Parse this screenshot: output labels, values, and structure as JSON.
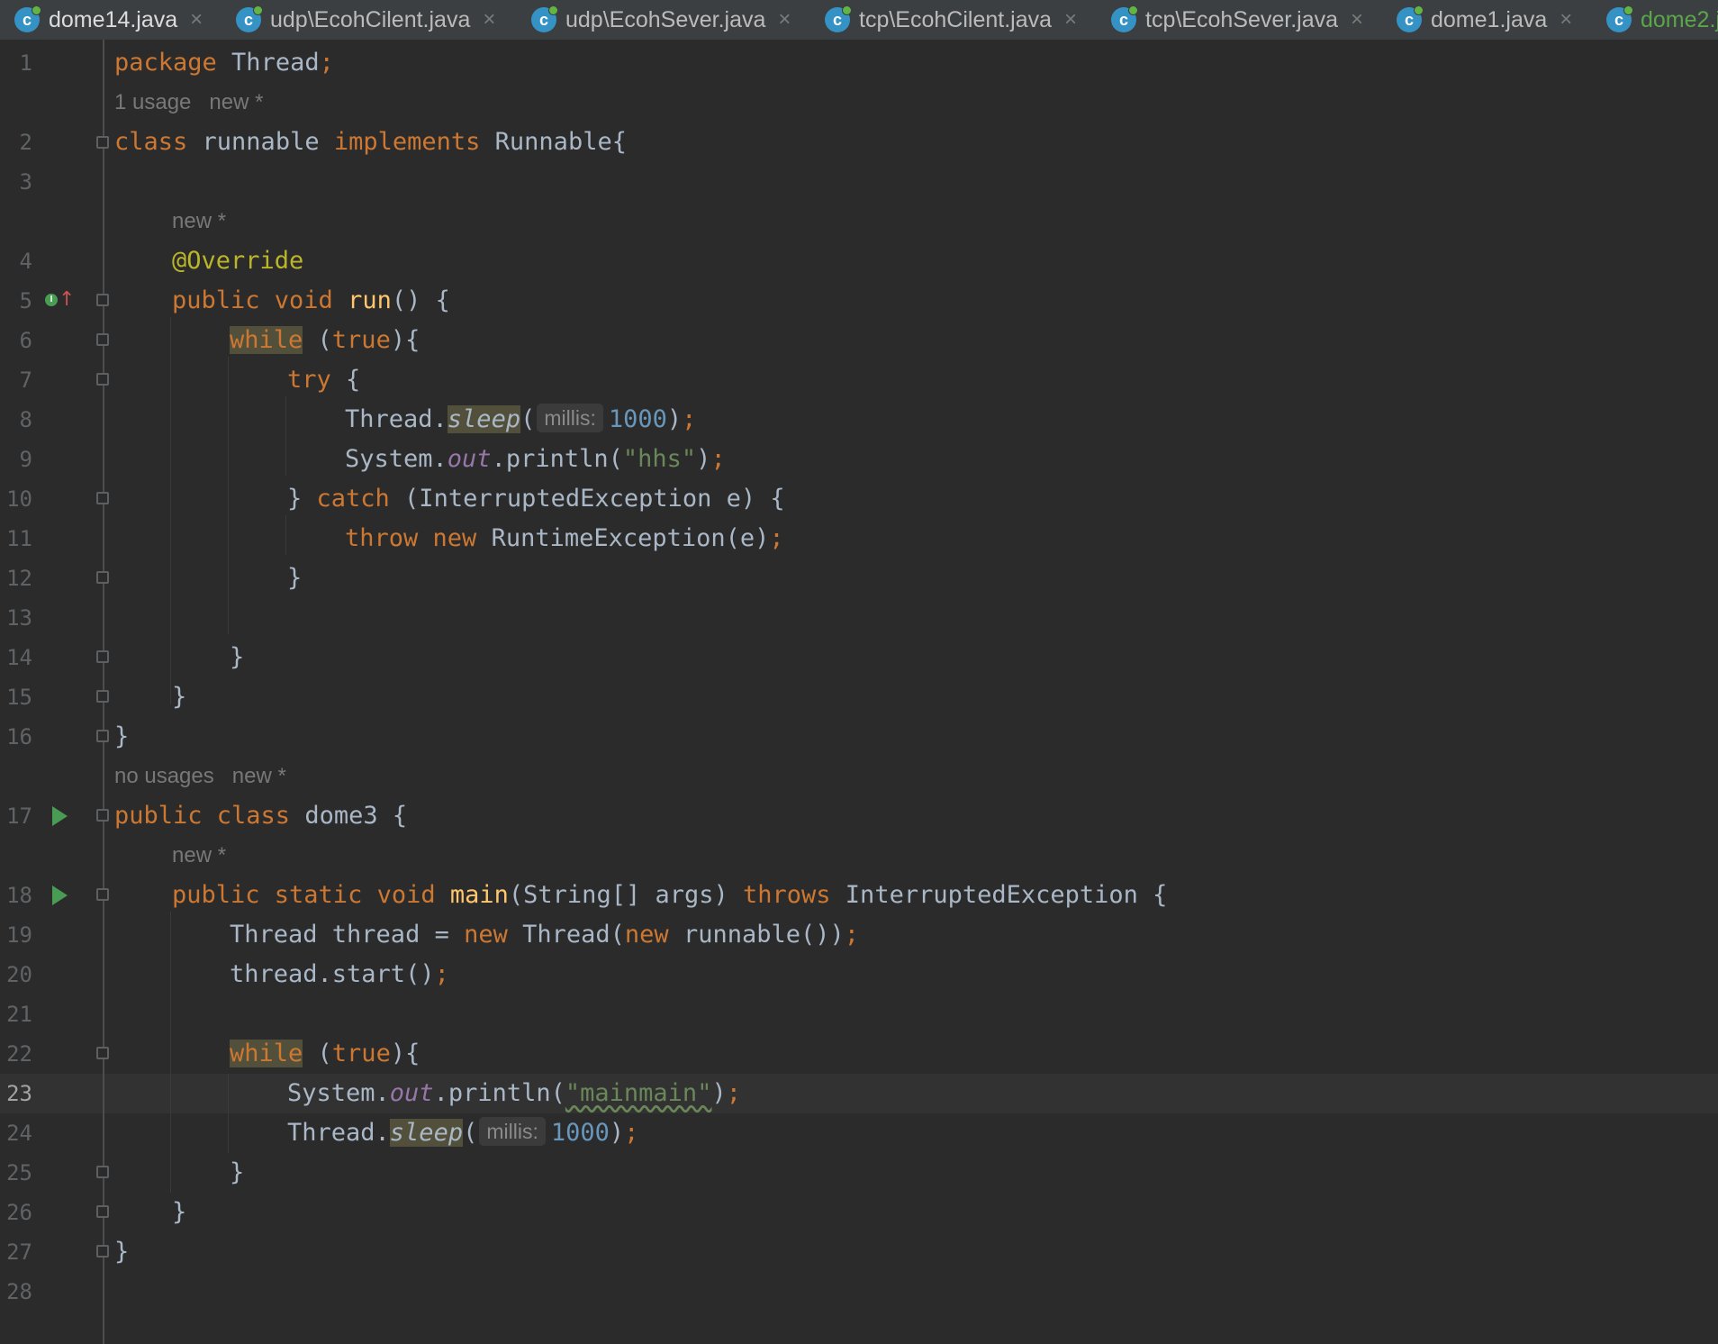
{
  "tabs": [
    {
      "label": "dome14.java",
      "close": "×"
    },
    {
      "label": "udp\\EcohCilent.java",
      "close": "×"
    },
    {
      "label": "udp\\EcohSever.java",
      "close": "×"
    },
    {
      "label": "tcp\\EcohCilent.java",
      "close": "×"
    },
    {
      "label": "tcp\\EcohSever.java",
      "close": "×"
    },
    {
      "label": "dome1.java",
      "close": "×"
    },
    {
      "label": "dome2.j",
      "close": ""
    }
  ],
  "tab_icon": "java-class-icon",
  "colors": {
    "background": "#2b2b2b",
    "keyword": "#cc7832",
    "string": "#6a8759",
    "number": "#6897bb",
    "annotation": "#bbb529",
    "method": "#ffc66d",
    "static_field": "#9876aa",
    "run_icon": "#499c54"
  },
  "lines": {
    "n1": "1",
    "n2": "2",
    "n3": "3",
    "n4": "4",
    "n5": "5",
    "n6": "6",
    "n7": "7",
    "n8": "8",
    "n9": "9",
    "n10": "10",
    "n11": "11",
    "n12": "12",
    "n13": "13",
    "n14": "14",
    "n15": "15",
    "n16": "16",
    "n17": "17",
    "n18": "18",
    "n19": "19",
    "n20": "20",
    "n21": "21",
    "n22": "22",
    "n23": "23",
    "n24": "24",
    "n25": "25",
    "n26": "26",
    "n27": "27",
    "n28": "28"
  },
  "hints": {
    "usage1": "1 usage   new *",
    "new_run": "new *",
    "usage2": "no usages   new *",
    "new_main": "new *",
    "param_millis": "millis:"
  },
  "code": {
    "l1_kw": "package",
    "l1_rest": " Thread",
    "l2_kw": "class",
    "l2_name": " runnable ",
    "l2_kw2": "implements",
    "l2_rest": " Runnable{",
    "l4_ann": "@Override",
    "l5_kw": "public void",
    "l5_fn": "run",
    "l5_rest": "() {",
    "l6_kw": "while",
    "l6_mid": " (",
    "l6_true": "true",
    "l6_rest": "){",
    "l7_kw": "try",
    "l7_rest": " {",
    "l8_a": "Thread.",
    "l8_sleep": "sleep",
    "l8_b": "(",
    "l8_num": "1000",
    "l8_c": ")",
    "l9_a": "System.",
    "l9_out": "out",
    "l9_b": ".println(",
    "l9_str": "\"hhs\"",
    "l9_c": ")",
    "l10_a": "} ",
    "l10_kw": "catch",
    "l10_rest": " (InterruptedException e) {",
    "l11_kw": "throw new",
    "l11_rest": " RuntimeException(e)",
    "l12": "}",
    "l14": "}",
    "l15": "}",
    "l16": "}",
    "l17_kw": "public class",
    "l17_rest": " dome3 {",
    "l18_kw": "public static void",
    "l18_fn": "main",
    "l18_mid": "(String[] args) ",
    "l18_kw2": "throws",
    "l18_rest": " InterruptedException {",
    "l19_a": "Thread thread = ",
    "l19_kw": "new",
    "l19_b": " Thread(",
    "l19_kw2": "new",
    "l19_c": " runnable())",
    "l20": "thread.start()",
    "l22_kw": "while",
    "l22_mid": " (",
    "l22_true": "true",
    "l22_rest": "){",
    "l23_a": "System.",
    "l23_out": "out",
    "l23_b": ".println(",
    "l23_str": "\"mainmain\"",
    "l23_c": ")",
    "l24_a": "Thread.",
    "l24_sleep": "sleep",
    "l24_b": "(",
    "l24_num": "1000",
    "l24_c": ")",
    "l25": "}",
    "l26": "}",
    "l27": "}",
    "semicolon": ";"
  }
}
